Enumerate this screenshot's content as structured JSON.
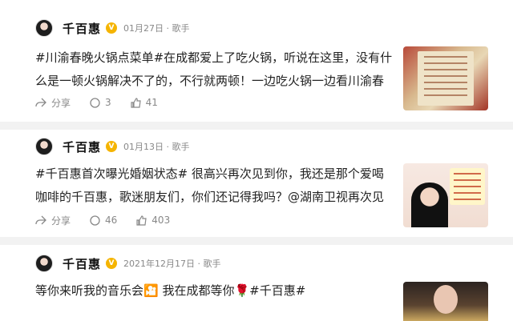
{
  "posts": [
    {
      "author": "千百惠",
      "badge": "V",
      "meta": "01月27日 · 歌手",
      "line1": "#川渝春晚火锅点菜单#在成都爱上了吃火锅，听说在这里，没有什",
      "line2": "么是一顿火锅解决不了的，不行就两顿！一边吃火锅一边看川渝春",
      "share_label": "分享",
      "comments": "3",
      "likes": "41"
    },
    {
      "author": "千百惠",
      "badge": "V",
      "meta": "01月13日 · 歌手",
      "line1": "#千百惠首次曝光婚姻状态# 很高兴再次见到你，我还是那个爱喝",
      "line2": "咖啡的千百惠，歌迷朋友们，你们还记得我吗？@湖南卫视再次见",
      "share_label": "分享",
      "comments": "46",
      "likes": "403"
    },
    {
      "author": "千百惠",
      "badge": "V",
      "meta": "2021年12月17日 · 歌手",
      "line1": "等你来听我的音乐会🎦 我在成都等你🌹#千百惠#"
    }
  ],
  "icons": {
    "share": "share-icon",
    "comment": "comment-icon",
    "like": "like-icon"
  },
  "colors": {
    "meta": "#888888",
    "badge": "#f5b400",
    "divider": "#f2f2f2"
  }
}
